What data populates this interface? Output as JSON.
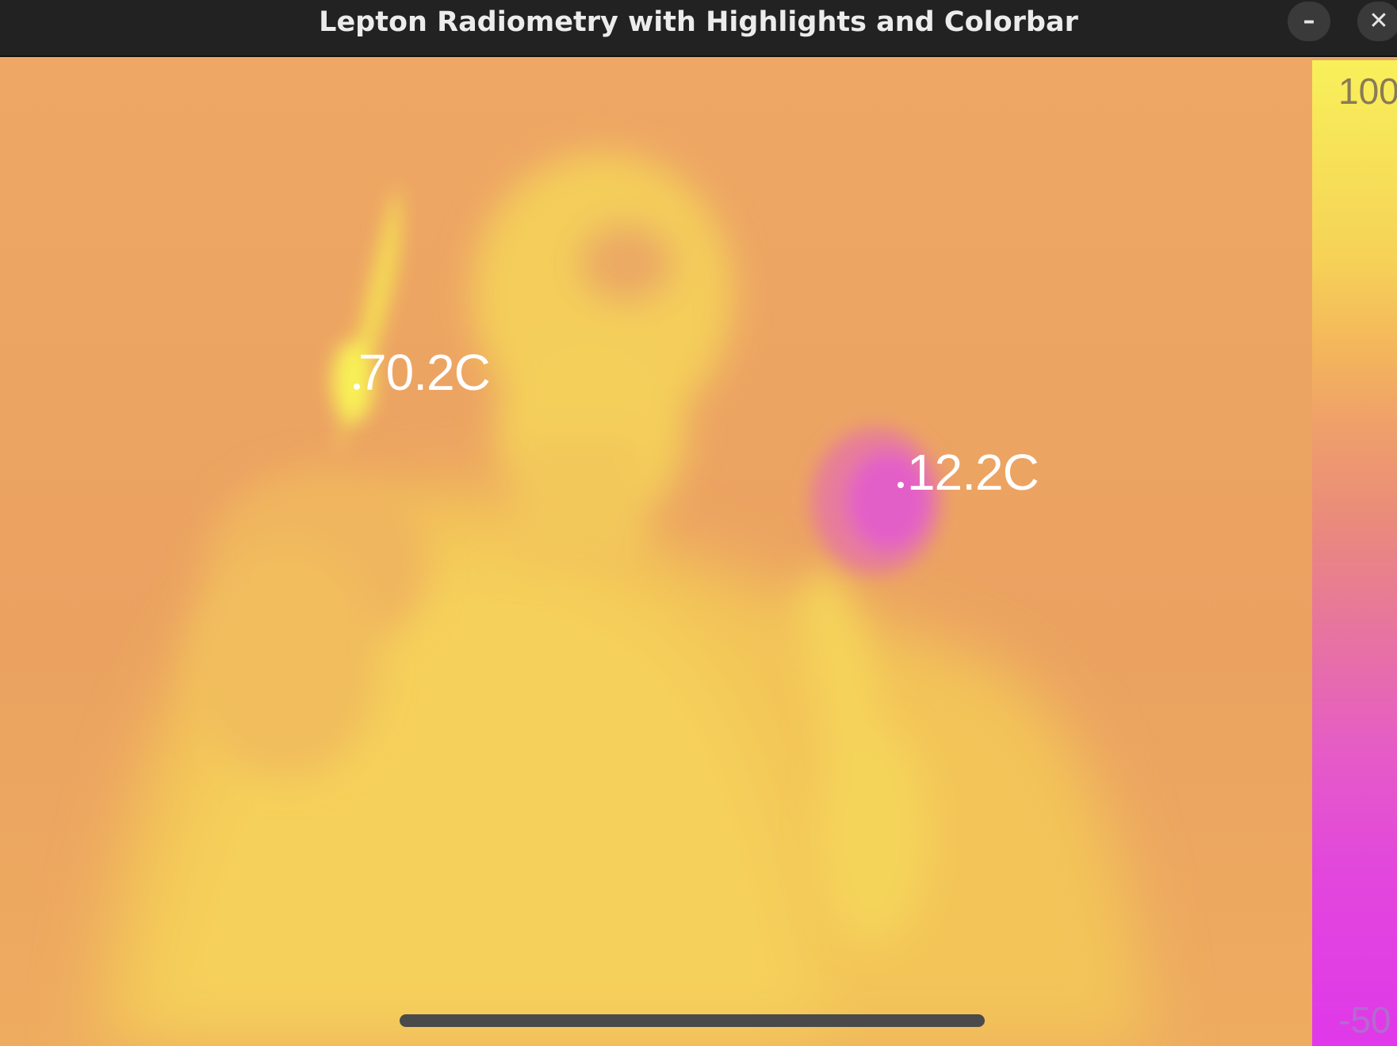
{
  "window": {
    "title": "Lepton Radiometry with Highlights and Colorbar",
    "minimize_glyph": "–",
    "close_glyph": "✕"
  },
  "thermal_view": {
    "hot_spot_label": "70.2C",
    "cold_spot_label": "12.2C"
  },
  "colorbar": {
    "max_label": "100",
    "min_label": "-50",
    "top_color": "#f8f05a",
    "bottom_color": "#e038ea"
  },
  "colors": {
    "background_warm": "#eba563",
    "body_hot": "#f5d25a",
    "cold_object": "#e35fc8"
  }
}
